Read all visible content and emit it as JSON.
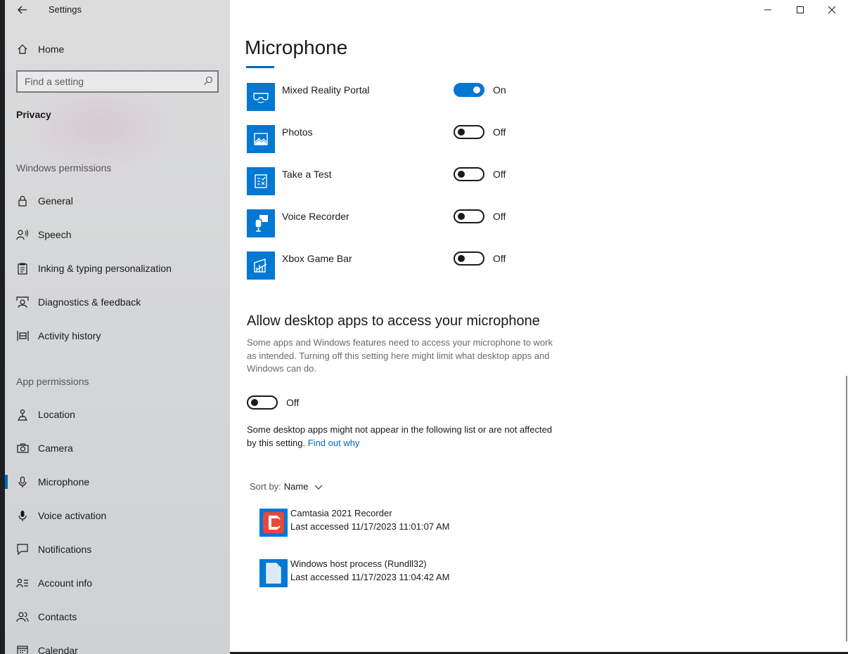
{
  "window": {
    "title": "Settings"
  },
  "sidebar": {
    "home": "Home",
    "search_placeholder": "Find a setting",
    "privacy": "Privacy",
    "section_windows": "Windows permissions",
    "windows_items": [
      {
        "label": "General",
        "icon": "lock-icon"
      },
      {
        "label": "Speech",
        "icon": "speech-icon"
      },
      {
        "label": "Inking & typing personalization",
        "icon": "inking-icon"
      },
      {
        "label": "Diagnostics & feedback",
        "icon": "feedback-icon"
      },
      {
        "label": "Activity history",
        "icon": "timeline-icon"
      }
    ],
    "section_app": "App permissions",
    "app_items": [
      {
        "label": "Location",
        "icon": "location-icon"
      },
      {
        "label": "Camera",
        "icon": "camera-icon"
      },
      {
        "label": "Microphone",
        "icon": "microphone-icon",
        "active": true
      },
      {
        "label": "Voice activation",
        "icon": "voice-icon"
      },
      {
        "label": "Notifications",
        "icon": "notifications-icon"
      },
      {
        "label": "Account info",
        "icon": "account-icon"
      },
      {
        "label": "Contacts",
        "icon": "contacts-icon"
      },
      {
        "label": "Calendar",
        "icon": "calendar-icon"
      }
    ]
  },
  "main": {
    "title": "Microphone",
    "apps": [
      {
        "name": "Mixed Reality Portal",
        "state": "On",
        "on": true,
        "icon": "mixed-reality-icon"
      },
      {
        "name": "Photos",
        "state": "Off",
        "on": false,
        "icon": "photos-icon"
      },
      {
        "name": "Take a Test",
        "state": "Off",
        "on": false,
        "icon": "take-a-test-icon"
      },
      {
        "name": "Voice Recorder",
        "state": "Off",
        "on": false,
        "icon": "voice-recorder-icon"
      },
      {
        "name": "Xbox Game Bar",
        "state": "Off",
        "on": false,
        "icon": "xbox-game-bar-icon"
      }
    ],
    "desktop_heading": "Allow desktop apps to access your microphone",
    "desktop_desc": "Some apps and Windows features need to access your microphone to work as intended. Turning off this setting here might limit what desktop apps and Windows can do.",
    "desktop_toggle_state": "Off",
    "note_text": "Some desktop apps might not appear in the following list or are not affected by this setting.",
    "note_link": "Find out why",
    "sort_label": "Sort by:",
    "sort_value": "Name",
    "desktop_apps": [
      {
        "name": "Camtasia 2021 Recorder",
        "accessed": "Last accessed 11/17/2023 11:01:07 AM",
        "icon": "camtasia-icon"
      },
      {
        "name": "Windows host process (Rundll32)",
        "accessed": "Last accessed 11/17/2023 11:04:42 AM",
        "icon": "file-icon"
      }
    ]
  },
  "colors": {
    "accent": "#0078d4",
    "link": "#0067c0",
    "camtasia": "#e8483a"
  }
}
